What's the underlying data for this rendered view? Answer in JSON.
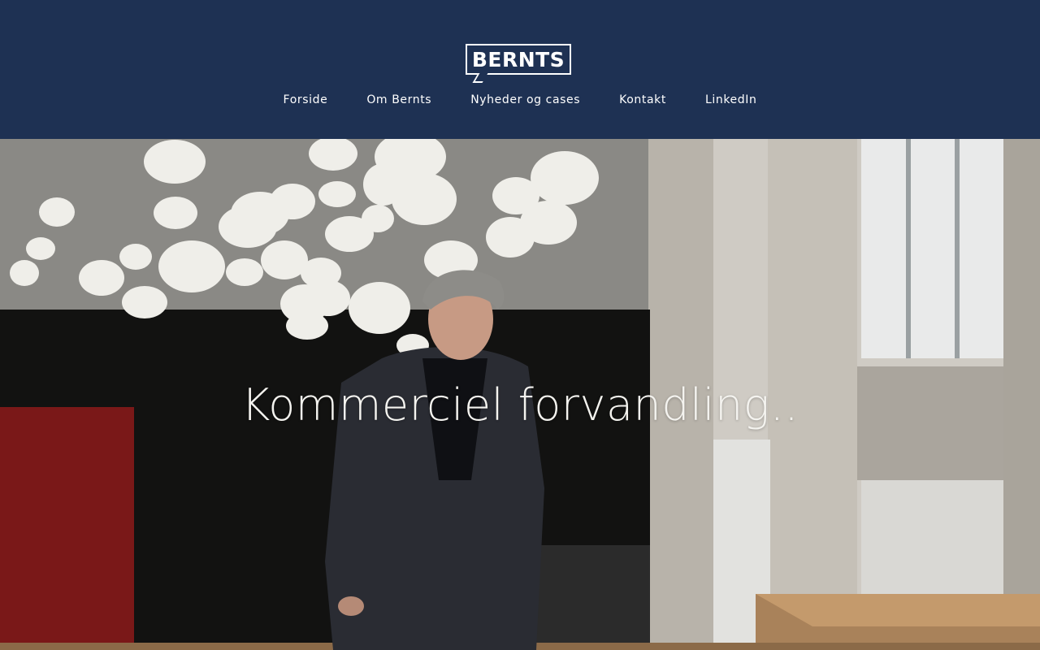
{
  "brand": {
    "logo_text": "BERNTS"
  },
  "nav": {
    "items": [
      {
        "label": "Forside"
      },
      {
        "label": "Om Bernts"
      },
      {
        "label": "Nyheder og cases"
      },
      {
        "label": "Kontakt"
      },
      {
        "label": "LinkedIn"
      }
    ]
  },
  "hero": {
    "title": "Kommerciel forvandling..",
    "image": "man-in-dark-suit-under-paper-lanterns-photo"
  },
  "colors": {
    "header_bg": "#1e3153",
    "text": "#ffffff"
  }
}
